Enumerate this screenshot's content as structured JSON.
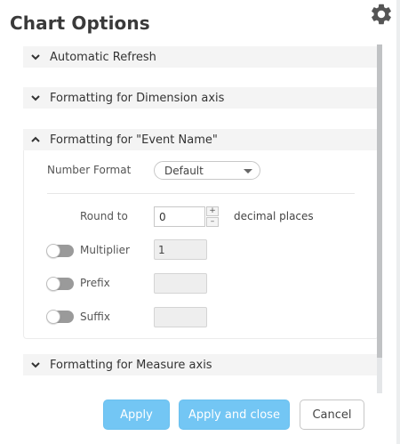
{
  "dialog": {
    "title": "Chart Options",
    "settings_icon": "gear-icon"
  },
  "sections": [
    {
      "label": "Automatic Refresh",
      "state": "collapsed",
      "icon": "chevron-down-icon"
    },
    {
      "label": "Formatting for Dimension axis",
      "state": "collapsed",
      "icon": "chevron-down-icon"
    },
    {
      "label": "Formatting for \"Event Name\"",
      "state": "expanded",
      "icon": "chevron-up-icon"
    },
    {
      "label": "Formatting for Measure axis",
      "state": "collapsed",
      "icon": "chevron-down-icon"
    }
  ],
  "formatting": {
    "number_format_label": "Number Format",
    "number_format_value": "Default",
    "round_to_label": "Round to",
    "round_to_value": "0",
    "decimal_places_label": "decimal places",
    "stepper_plus": "+",
    "stepper_minus": "–",
    "multiplier_label": "Multiplier",
    "multiplier_value": "1",
    "multiplier_enabled": false,
    "prefix_label": "Prefix",
    "prefix_value": "",
    "prefix_enabled": false,
    "suffix_label": "Suffix",
    "suffix_value": "",
    "suffix_enabled": false
  },
  "footer": {
    "apply_label": "Apply",
    "apply_close_label": "Apply and close",
    "cancel_label": "Cancel"
  },
  "colors": {
    "primary_button": "#73c6f4",
    "section_header_bg": "#f4f4f4",
    "toggle_off": "#9a9a9a"
  }
}
